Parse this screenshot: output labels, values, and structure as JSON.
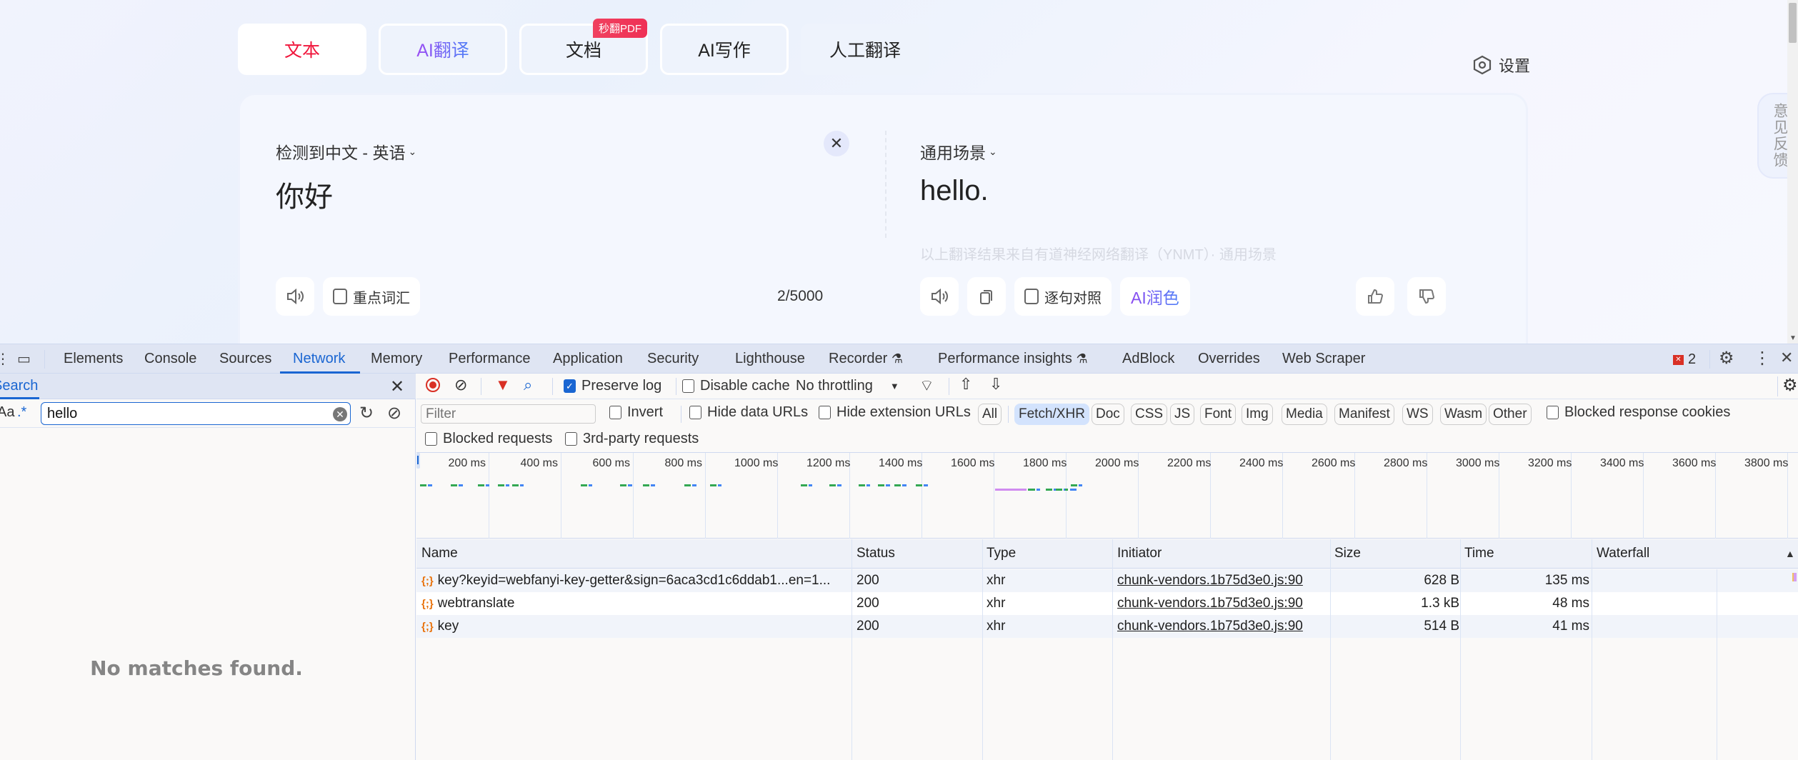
{
  "page": {
    "tabs": [
      {
        "label": "文本",
        "active": true
      },
      {
        "label": "AI翻译",
        "active": false
      },
      {
        "label": "文档",
        "active": false,
        "badge": "秒翻PDF"
      },
      {
        "label": "AI写作",
        "active": false
      },
      {
        "label": "人工翻译",
        "active": false
      }
    ],
    "settings_label": "设置",
    "feedback_label": "意见反馈",
    "source": {
      "language_selector": "检测到中文 - 英语",
      "text": "你好",
      "clear_icon": "close-icon",
      "key_vocab_label": "重点词汇",
      "char_count": "2/5000"
    },
    "target": {
      "scene_selector": "通用场景",
      "text": "hello.",
      "source_note": "以上翻译结果来自有道神经网络翻译（YNMT）· 通用场景",
      "sentence_compare_label": "逐句对照",
      "ai_polish_label": "AI润色"
    },
    "colors": {
      "active_tab": "#f0153b",
      "ai_gradient_start": "#9b4df3",
      "ai_gradient_end": "#4f7ff7",
      "badge": "#f0405f"
    }
  },
  "devtools": {
    "tabs": [
      "Elements",
      "Console",
      "Sources",
      "Network",
      "Memory",
      "Performance",
      "Application",
      "Security",
      "Lighthouse",
      "Recorder",
      "Performance insights",
      "AdBlock",
      "Overrides",
      "Web Scraper"
    ],
    "active_tab": "Network",
    "error_count": "2",
    "search": {
      "title": "Search",
      "regex_label": ".*",
      "case_label": "Aa",
      "query": "hello",
      "empty_message": "No matches found."
    },
    "network_toolbar": {
      "preserve_log_label": "Preserve log",
      "preserve_log_checked": true,
      "disable_cache_label": "Disable cache",
      "disable_cache_checked": false,
      "throttling": "No throttling"
    },
    "filter": {
      "placeholder": "Filter",
      "invert_label": "Invert",
      "hide_data_urls_label": "Hide data URLs",
      "hide_extension_urls_label": "Hide extension URLs",
      "types": [
        "All",
        "Fetch/XHR",
        "Doc",
        "CSS",
        "JS",
        "Font",
        "Img",
        "Media",
        "Manifest",
        "WS",
        "Wasm",
        "Other"
      ],
      "active_type": "Fetch/XHR",
      "blocked_cookies_label": "Blocked response cookies",
      "blocked_requests_label": "Blocked requests",
      "third_party_label": "3rd-party requests"
    },
    "overview": {
      "ticks": [
        "200 ms",
        "400 ms",
        "600 ms",
        "800 ms",
        "1000 ms",
        "1200 ms",
        "1400 ms",
        "1600 ms",
        "1800 ms",
        "2000 ms",
        "2200 ms",
        "2400 ms",
        "2600 ms",
        "2800 ms",
        "3000 ms",
        "3200 ms",
        "3400 ms",
        "3600 ms",
        "3800 ms"
      ],
      "colors": {
        "waiting": "#34a853",
        "download": "#4285f4",
        "queue": "#d08cf0"
      }
    },
    "table": {
      "columns": [
        "Name",
        "Status",
        "Type",
        "Initiator",
        "Size",
        "Time",
        "Waterfall"
      ],
      "rows": [
        {
          "name": "key?keyid=webfanyi-key-getter&sign=6aca3cd1c6ddab1...en=1...",
          "status": "200",
          "type": "xhr",
          "initiator": "chunk-vendors.1b75d3e0.js:90",
          "size": "628 B",
          "time": "135 ms"
        },
        {
          "name": "webtranslate",
          "status": "200",
          "type": "xhr",
          "initiator": "chunk-vendors.1b75d3e0.js:90",
          "size": "1.3 kB",
          "time": "48 ms"
        },
        {
          "name": "key",
          "status": "200",
          "type": "xhr",
          "initiator": "chunk-vendors.1b75d3e0.js:90",
          "size": "514 B",
          "time": "41 ms"
        }
      ]
    }
  }
}
